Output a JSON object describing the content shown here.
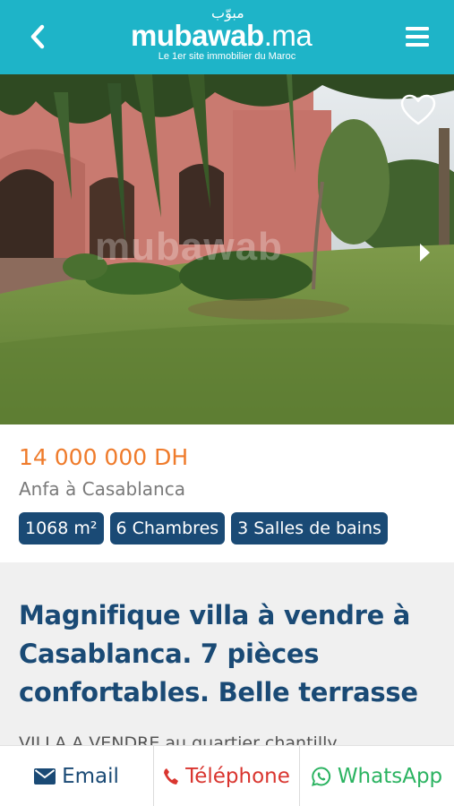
{
  "header": {
    "logo_arabic": "مبوّب",
    "logo_name": "mubawab",
    "logo_tld": ".ma",
    "tagline": "Le 1er site immobilier du Maroc",
    "back_icon": "chevron-left-icon",
    "menu_icon": "hamburger-menu-icon"
  },
  "photo": {
    "watermark": "mubawab",
    "favorite_icon": "heart-outline-icon",
    "next_icon": "caret-right-icon"
  },
  "listing": {
    "price": "14 000 000 DH",
    "location": "Anfa à Casablanca",
    "features": [
      "1068 m²",
      "6 Chambres",
      "3 Salles de bains"
    ]
  },
  "description": {
    "title": "Magnifique villa à vendre à Casablanca. 7 pièces confortables. Belle terrasse",
    "text": "VILLA A VENDRE au quartier chantilly"
  },
  "actions": {
    "email": "Email",
    "phone": "Téléphone",
    "whatsapp": "WhatsApp"
  },
  "colors": {
    "header_bg": "#1eb4c8",
    "price": "#ef7b2b",
    "badge_bg": "#1a4a75",
    "title": "#1a4a75",
    "phone": "#d9352f",
    "whatsapp": "#2bb361"
  }
}
